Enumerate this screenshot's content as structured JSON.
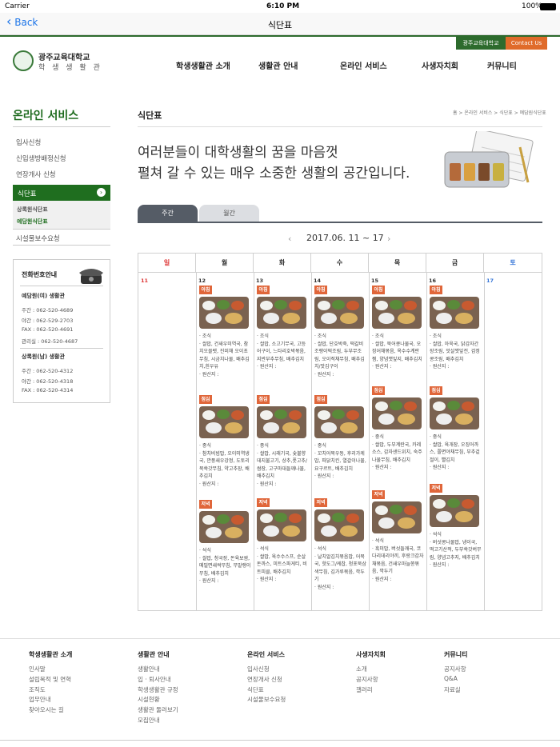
{
  "status": {
    "carrier": "Carrier",
    "time": "6:10 PM",
    "battery": "100%"
  },
  "navbar": {
    "back": "Back",
    "title": "식단표"
  },
  "top_buttons": [
    "광주교육대학교",
    "Contact Us"
  ],
  "logo": {
    "line1": "광주교육대학교",
    "line2": "학 생 생 활 관"
  },
  "gnb": [
    "학생생활관 소개",
    "생활관 안내",
    "온라인 서비스",
    "사생자치회",
    "커뮤니티"
  ],
  "lnb": {
    "title": "온라인 서비스",
    "items": [
      "입사신청",
      "신입생방배정신청",
      "연장개사 신청"
    ],
    "active": "식단표",
    "sub": [
      "상록원식단표",
      "예담원식단표"
    ],
    "after": "시설물보수요청"
  },
  "phone": {
    "title": "전화번호안내",
    "h1": "예담원(여) 생활관",
    "l1": [
      "주간 : 062-520-4689",
      "야간 : 062-529-2703",
      "FAX : 062-520-4691",
      "관리실 : 062-520-4687"
    ],
    "h2": "상록원(남) 생활관",
    "l2": [
      "주간 : 062-520-4312",
      "야간 : 062-520-4318",
      "FAX : 062-520-4314"
    ]
  },
  "page": {
    "title": "식단표",
    "breadcrumb": "홈 > 온라인 서비스 > 식단표 > 예담원식단표",
    "slogan1": "여러분들이 대학생활의 꿈을 마음껏",
    "slogan2": "펼쳐 갈 수 있는 매우 소중한 생활의 공간입니다."
  },
  "tabs": [
    "주간",
    "월간"
  ],
  "week": "2017.06. 11 ~ 17",
  "weekdays": [
    "일",
    "월",
    "화",
    "수",
    "목",
    "금",
    "토"
  ],
  "dates": [
    "11",
    "12",
    "13",
    "14",
    "15",
    "16",
    "17"
  ],
  "meal_tags": [
    "아침",
    "점심",
    "저녁"
  ],
  "menus": [
    [
      "· 조식\n· 쌀밥, 건새우미역국, 참치오믈렛, 진미채 오이초무침, 시금치나물, 배추김치,흰우유\n· 원산지 :",
      "· 중식\n· 참치비빔밥, 오이미역냉국, 깐풍새우강정, 도토리묵쑥갓무침, 약고추장, 배추김치\n· 원산지 :",
      "· 석식\n· 쌀밥, 청국장, 돈육보쌈, 메밀면새싹무침, 무말랭이무침, 배추김치\n· 원산지 :"
    ],
    [
      "· 조식\n· 쌀밥, 소고기무국, 고등어구이, 느타리호박볶음, 지반부추무침, 배추김치\n· 원산지 :",
      "· 중식\n· 쌀밥, 시래기국, 숯불향데지불고기, 상추,풋고추/쌈장, 고구마대들깨나물, 배추김치\n· 원산지 :",
      "· 석식\n· 쌀밥, 육수수스프, 순살돈까스, 미트스파게티, 비트피클, 배추김치\n· 원산지 :"
    ],
    [
      "· 조식\n· 쌀밥, 단호박죽, 떡갈비조랭이떡조림, 두부무조림, 오이적채무침, 배추김치/맛김구이\n· 원산지 :",
      "· 중식\n· 꼬치어묵우동, 후리가케밥, 파닭치킨, 열갈이나물, 요구르트, 배추김치\n· 원산지 :",
      "· 석식\n· 날치알김치볶음밥, 어묵국, 핫도그/케찹, 청포묵삼색무침, 김가루볶음, 깍두기\n· 원산지 :"
    ],
    [
      "· 조식\n· 쌀밥, 북어콩나물국, 오징어채볶음, 옥수수계란찜, 양념깻잎지, 배추김치\n· 원산지 :",
      "· 중식\n· 쌀밥, 두부계란국, 카레소스, 감자샌드위치, 숙주나물무침, 배추김치\n· 원산지 :",
      "· 석식\n· 흑미밥, 버섯들깨국, 코다리데리야끼, 후랑크감자채볶음, 건새우마늘쫑볶음, 깍두기\n· 원산지 :"
    ],
    [
      "· 조식\n· 쌀밥, 아욱국, 닭감자간장조림, 맛살깻잎전, 검정콩조림, 배추김치\n· 원산지 :",
      "· 중식\n· 쌀밥, 육개장, 오징어까스, 쫄면야채무침, 부추겉절이, 빨김치\n· 원산지 :",
      "· 석식\n· 버섯콩나물밥, 냉이국, 떡고기산적, 두부쑥갓버무림, 양념고추지, 배추김치\n· 원산지 :"
    ]
  ],
  "footer": [
    {
      "title": "학생생활관 소개",
      "links": [
        "인사말",
        "설립목적 및 연혁",
        "조직도",
        "업무안내",
        "찾아오시는 길"
      ]
    },
    {
      "title": "생활관 안내",
      "links": [
        "생활안내",
        "입 · 퇴사안내",
        "학생생활관 규정",
        "시설현황",
        "생활관 둘러보기",
        "모집안내"
      ]
    },
    {
      "title": "온라인 서비스",
      "links": [
        "입사신청",
        "연장개사 신청",
        "식단표",
        "시설물보수요청"
      ]
    },
    {
      "title": "사생자치회",
      "links": [
        "소개",
        "공지사항",
        "갤러리"
      ]
    },
    {
      "title": "커뮤니티",
      "links": [
        "공지사항",
        "Q&A",
        "자료실"
      ]
    }
  ],
  "colors": {
    "green": "#1f6e1f",
    "orange": "#e06b2a",
    "tag": "#e0663a"
  }
}
